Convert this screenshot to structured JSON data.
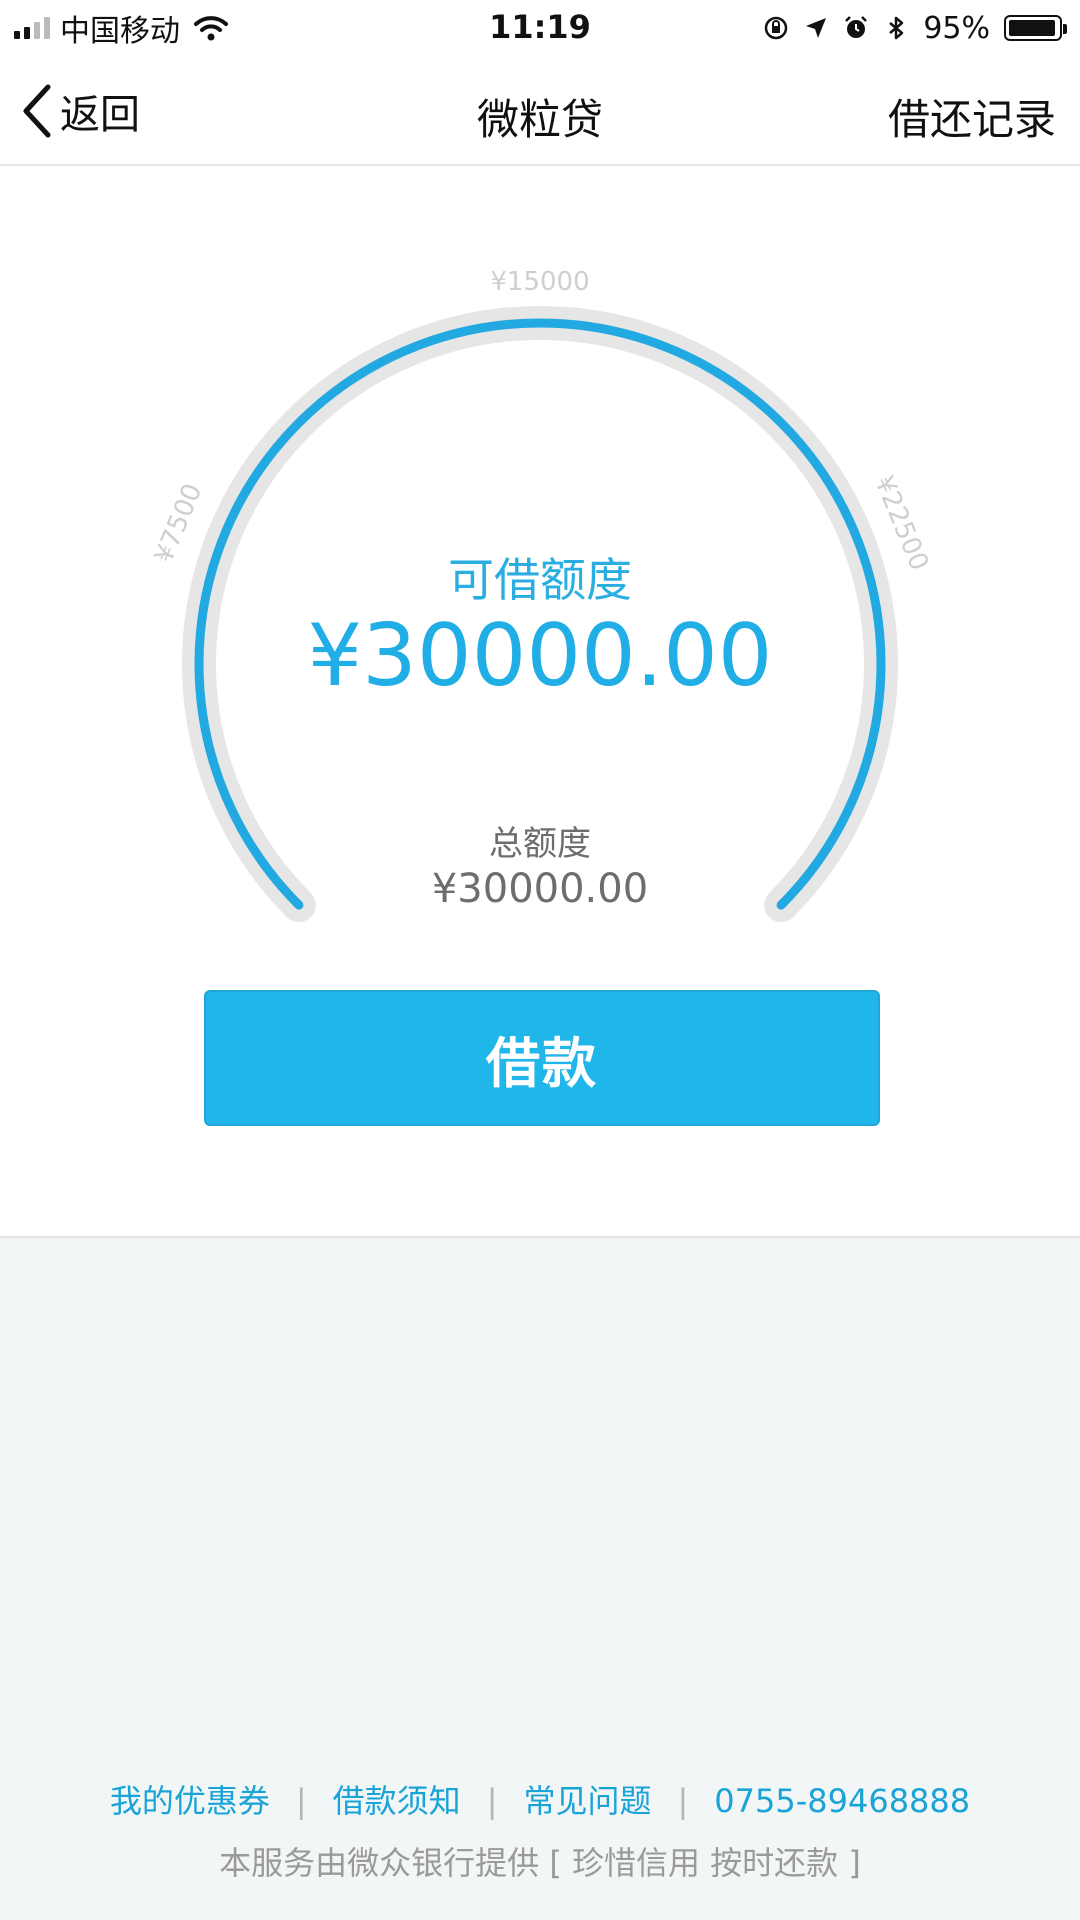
{
  "status_bar": {
    "carrier": "中国移动",
    "time": "11:19",
    "battery_percent": "95%",
    "battery_level": 0.95,
    "icons": [
      "signal-icon",
      "wifi-icon",
      "orientation-lock-icon",
      "location-icon",
      "alarm-icon",
      "bluetooth-icon",
      "battery-icon"
    ]
  },
  "nav": {
    "back_label": "返回",
    "title": "微粒贷",
    "right_label": "借还记录"
  },
  "gauge": {
    "ticks": [
      "¥7500",
      "¥15000",
      "¥22500"
    ],
    "available_label": "可借额度",
    "available_amount": "¥30000.00",
    "available_fraction": 1.0,
    "total_label": "总额度",
    "total_amount": "¥30000.00",
    "colors": {
      "track": "#e6e6e6",
      "arc": "#22a9e1"
    }
  },
  "borrow_button": {
    "label": "借款",
    "color": "#20b6ea"
  },
  "footer": {
    "links": [
      "我的优惠券",
      "借款须知",
      "常见问题",
      "0755-89468888"
    ],
    "separator": "|",
    "note": "本服务由微众银行提供 [ 珍惜信用 按时还款 ]"
  }
}
